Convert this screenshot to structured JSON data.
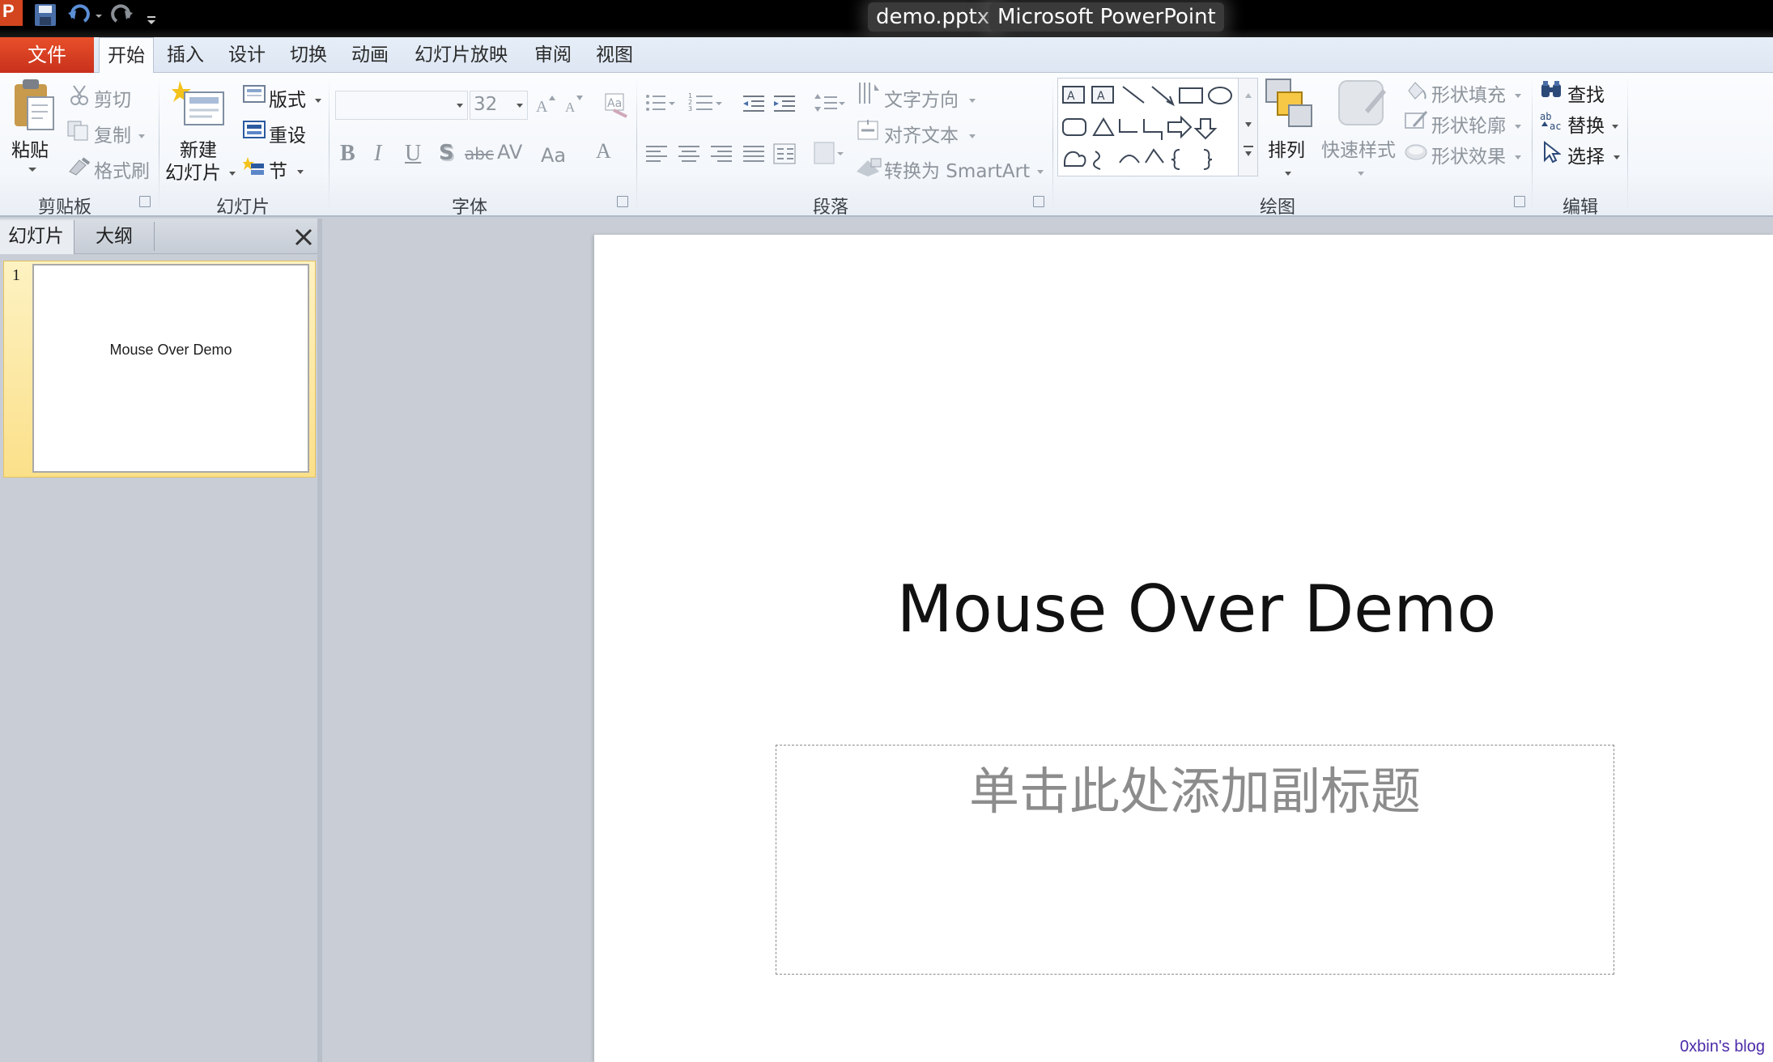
{
  "window": {
    "file_name": "demo.pptx",
    "app_name": "Microsoft PowerPoint"
  },
  "quick_access": {
    "icons": [
      "powerpoint-logo-icon",
      "save-icon",
      "undo-icon",
      "redo-icon",
      "customize-icon"
    ]
  },
  "tabs": {
    "file": "文件",
    "home": "开始",
    "insert": "插入",
    "design": "设计",
    "transitions": "切换",
    "animations": "动画",
    "slideshow": "幻灯片放映",
    "review": "审阅",
    "view": "视图"
  },
  "ribbon": {
    "clipboard": {
      "paste": "粘贴",
      "cut": "剪切",
      "copy": "复制",
      "format_painter": "格式刷",
      "label": "剪贴板"
    },
    "slides": {
      "new_slide_line1": "新建",
      "new_slide_line2": "幻灯片",
      "layout": "版式",
      "reset": "重设",
      "section": "节",
      "label": "幻灯片"
    },
    "font": {
      "font_name": "",
      "font_size": "32",
      "bold": "B",
      "italic": "I",
      "underline": "U",
      "shadow": "S",
      "strikethrough": "abc",
      "spacing": "AV",
      "case": "Aa",
      "color": "A",
      "label": "字体"
    },
    "paragraph": {
      "text_direction": "文字方向",
      "align_text": "对齐文本",
      "convert_smartart": "转换为 SmartArt",
      "label": "段落"
    },
    "drawing": {
      "arrange": "排列",
      "quick_styles": "快速样式",
      "shape_fill": "形状填充",
      "shape_outline": "形状轮廓",
      "shape_effects": "形状效果",
      "label": "绘图"
    },
    "editing": {
      "find": "查找",
      "replace": "替换",
      "select": "选择",
      "label": "编辑"
    }
  },
  "left_pane": {
    "tab_slides": "幻灯片",
    "tab_outline": "大纲",
    "slide_number": "1",
    "thumb_title": "Mouse Over Demo"
  },
  "slide": {
    "title": "Mouse Over Demo",
    "subtitle_placeholder": "单击此处添加副标题"
  },
  "watermark": "0xbin's blog"
}
